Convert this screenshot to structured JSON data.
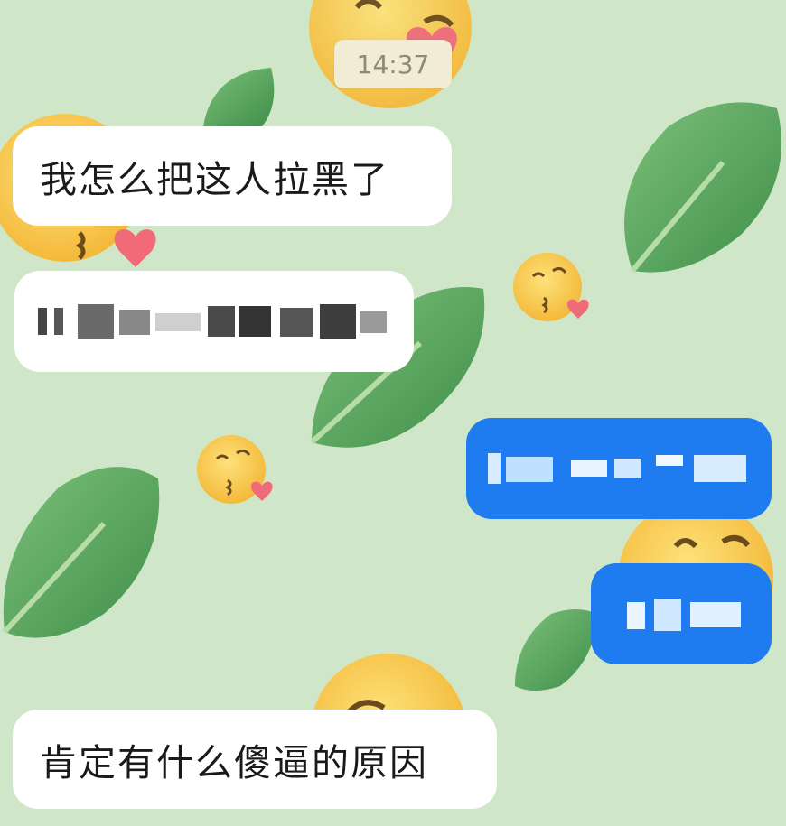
{
  "conversation": {
    "timestamp": "14:37",
    "messages": [
      {
        "side": "incoming",
        "text": "我怎么把这人拉黑了",
        "redacted": false
      },
      {
        "side": "incoming",
        "text": "",
        "redacted": true
      },
      {
        "side": "outgoing",
        "text": "",
        "redacted": true
      },
      {
        "side": "outgoing",
        "text": "",
        "redacted": true
      },
      {
        "side": "incoming",
        "text": "肯定有什么傻逼的原因",
        "redacted": false
      }
    ]
  },
  "background": {
    "color": "#cfe7c8",
    "decorations": [
      "lettuce-icon",
      "kissing-face-icon"
    ]
  },
  "colors": {
    "incoming_bubble": "#ffffff",
    "outgoing_bubble": "#1e7bf0",
    "timestamp_bg": "#f3ecd5"
  }
}
